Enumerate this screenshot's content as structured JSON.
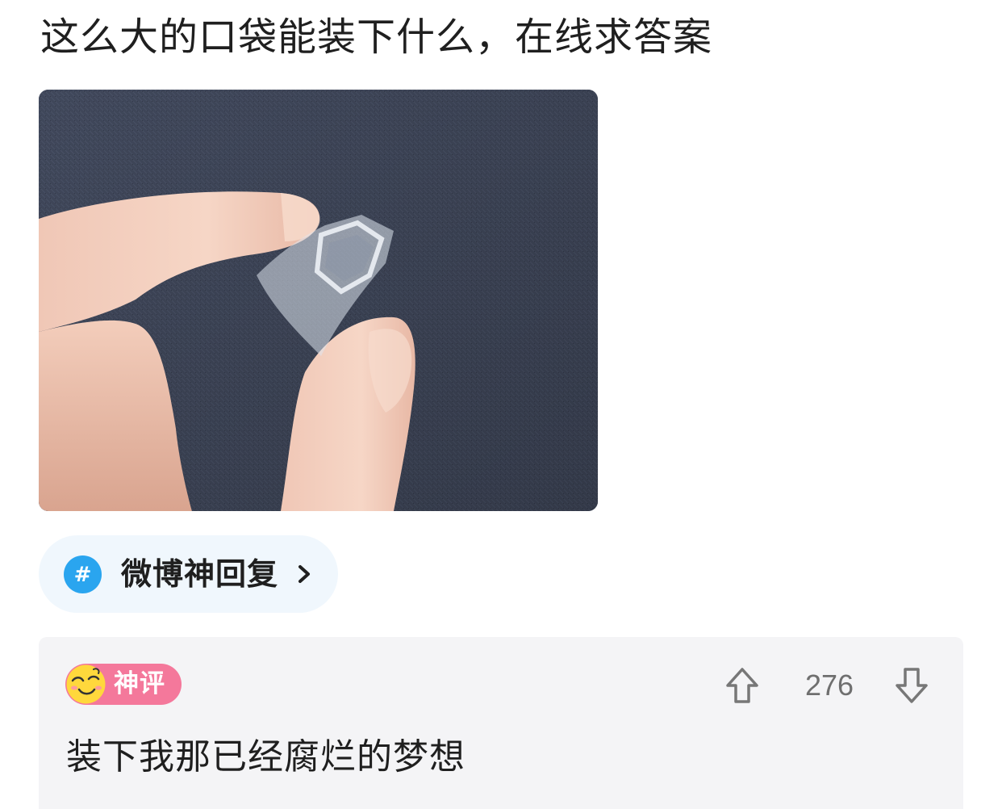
{
  "post": {
    "title": "这么大的口袋能装下什么，在线求答案",
    "image": {
      "description_icon": "photo-of-tiny-ziplock-bag"
    }
  },
  "topic": {
    "hash": "#",
    "label": "微博神回复",
    "icon": "chevron-right-icon",
    "colors": {
      "chip_bg": "#f0f7fd",
      "hash_bg": "#2aa5ef"
    }
  },
  "comment": {
    "badge_label": "神评",
    "badge_icon": "smiling-face-icon",
    "vote_count": "276",
    "text": "装下我那已经腐烂的梦想",
    "colors": {
      "badge_bg": "#f4789b",
      "card_bg": "#f4f4f6"
    }
  }
}
